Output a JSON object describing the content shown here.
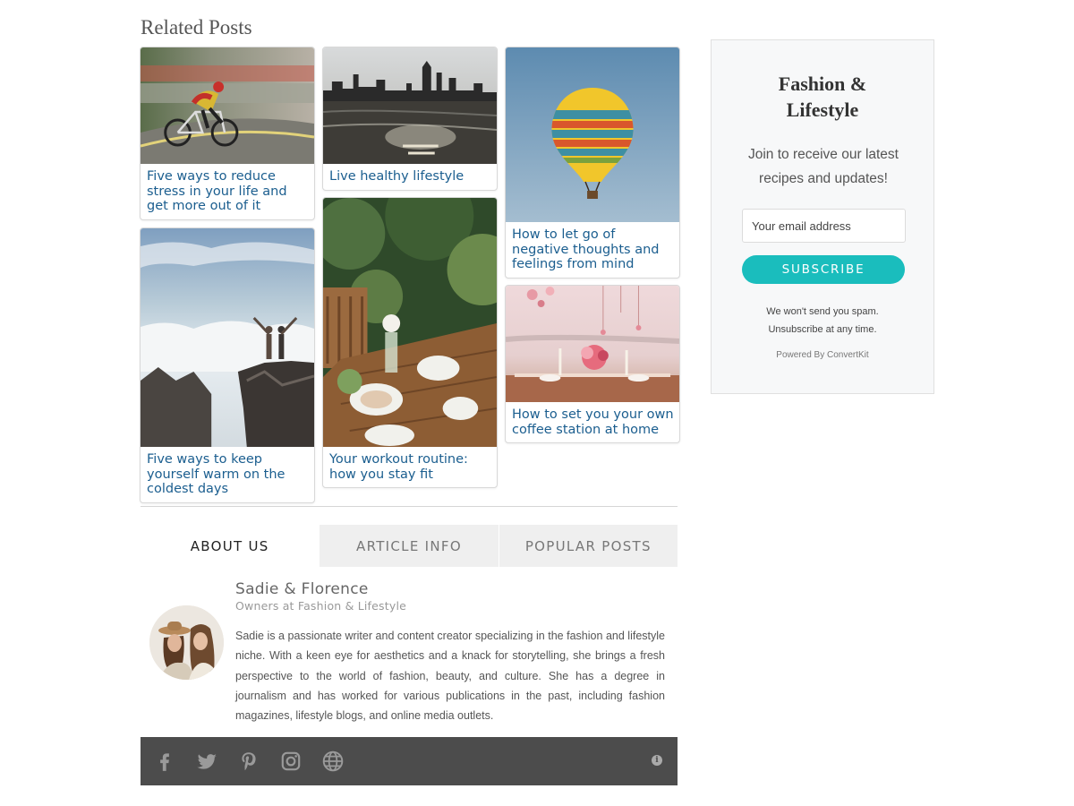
{
  "related": {
    "title": "Related Posts",
    "posts": [
      {
        "title": "Five ways to reduce stress in your life and get more out of it",
        "image": "cyclist-photo"
      },
      {
        "title": "Live healthy lifestyle",
        "image": "city-lake-photo"
      },
      {
        "title": "How to let go of negative thoughts and feelings from mind",
        "image": "hot-air-balloon-photo"
      },
      {
        "title": "Five ways to keep yourself warm on the coldest days",
        "image": "mountain-clouds-photo"
      },
      {
        "title": "Your workout routine: how you stay fit",
        "image": "garden-table-photo"
      },
      {
        "title": "How to set you your own coffee station at home",
        "image": "dining-table-photo"
      }
    ]
  },
  "tabs": [
    {
      "label": "ABOUT US",
      "active": true
    },
    {
      "label": "ARTICLE INFO",
      "active": false
    },
    {
      "label": "POPULAR POSTS",
      "active": false
    }
  ],
  "author": {
    "name": "Sadie & Florence",
    "role": "Owners at Fashion & Lifestyle",
    "bio": "Sadie is a passionate writer and content creator specializing in the fashion and lifestyle niche. With a keen eye for aesthetics and a knack for storytelling, she brings a fresh perspective to the world of fashion, beauty, and culture. She has a degree in journalism and has worked for various publications in the past, including fashion magazines, lifestyle blogs, and online media outlets."
  },
  "social": {
    "icons": [
      "facebook-icon",
      "twitter-icon",
      "pinterest-icon",
      "instagram-icon",
      "globe-icon",
      "info-icon"
    ]
  },
  "newsletter": {
    "title_line1": "Fashion &",
    "title_line2": "Lifestyle",
    "description": "Join to receive our latest recipes and updates!",
    "email_placeholder": "Your email address",
    "button_label": "SUBSCRIBE",
    "note_line1": "We won't send you spam.",
    "note_line2": "Unsubscribe at any time.",
    "powered_by": "Powered By ConvertKit"
  },
  "colors": {
    "link": "#1b5e8f",
    "accent": "#1abdbd",
    "social_bar": "#4c4c4c"
  }
}
